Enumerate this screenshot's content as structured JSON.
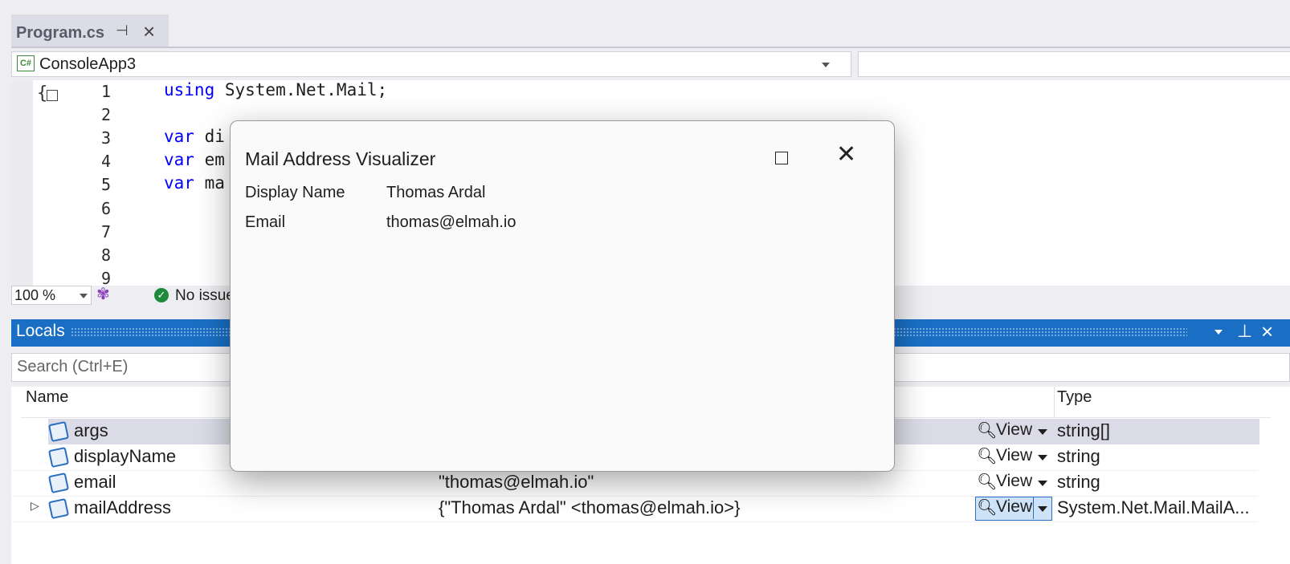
{
  "tab": {
    "title": "Program.cs"
  },
  "navbar": {
    "project": "ConsoleApp3",
    "project_icon": "C#"
  },
  "editor": {
    "lines": [
      {
        "num": "1",
        "kw": "using",
        "rest": " System.Net.Mail;"
      },
      {
        "num": "2",
        "kw": "",
        "rest": ""
      },
      {
        "num": "3",
        "kw": "var",
        "rest": " di"
      },
      {
        "num": "4",
        "kw": "var",
        "rest": " em"
      },
      {
        "num": "5",
        "kw": "var",
        "rest": " ma"
      },
      {
        "num": "6",
        "kw": "",
        "rest": ""
      },
      {
        "num": "7",
        "kw": "",
        "rest": ""
      },
      {
        "num": "8",
        "kw": "",
        "rest": ""
      },
      {
        "num": "9",
        "kw": "",
        "rest": ""
      }
    ],
    "zoom": "100 %",
    "issues_status": "No issue"
  },
  "locals": {
    "title": "Locals",
    "search_placeholder": "Search (Ctrl+E)",
    "columns": {
      "name": "Name",
      "type": "Type"
    },
    "view_label": "View",
    "rows": [
      {
        "name": "args",
        "value": "",
        "type": "string[]"
      },
      {
        "name": "displayName",
        "value": "",
        "type": "string"
      },
      {
        "name": "email",
        "value": "\"thomas@elmah.io\"",
        "type": "string"
      },
      {
        "name": "mailAddress",
        "value": "{\"Thomas Ardal\" <thomas@elmah.io>}",
        "type": "System.Net.Mail.MailA..."
      }
    ]
  },
  "dialog": {
    "title": "Mail Address Visualizer",
    "fields": [
      {
        "label": "Display Name",
        "value": "Thomas Ardal"
      },
      {
        "label": "Email",
        "value": "thomas@elmah.io"
      }
    ]
  },
  "colors": {
    "accent": "#1a6fc4",
    "keyword": "#0000ff",
    "success": "#1f8a3b"
  }
}
